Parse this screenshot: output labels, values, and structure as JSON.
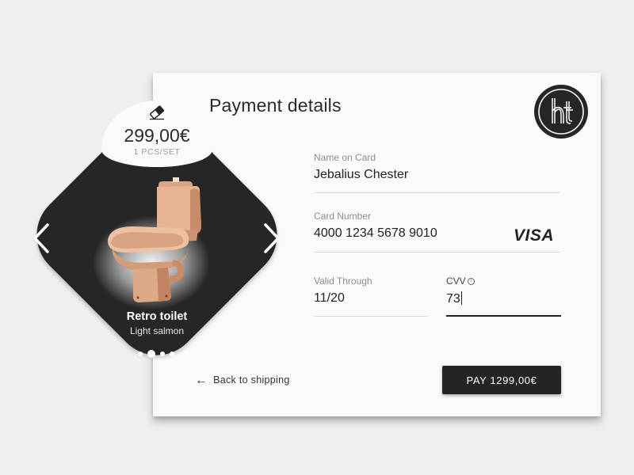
{
  "payment": {
    "title": "Payment details",
    "logo_icon": "ht-monogram-logo-icon",
    "fields": {
      "name": {
        "label": "Name on Card",
        "value": "Jebalius Chester"
      },
      "card_number": {
        "label": "Card Number",
        "value": "4000 1234 5678 9010",
        "brand": "VISA"
      },
      "valid_through": {
        "label": "Valid Through",
        "value": "11/20"
      },
      "cvv": {
        "label": "CVV",
        "value": "73",
        "info_glyph": "i"
      }
    },
    "back_link": {
      "arrow": "←",
      "label": "Back to shipping"
    },
    "pay_button": {
      "label": "PAY 1299,00€"
    }
  },
  "product": {
    "price": "299,00€",
    "unit": "1 PCS/SET",
    "name": "Retro toilet",
    "variant": "Light salmon",
    "carousel": {
      "count": 4,
      "active_index": 1
    },
    "icons": {
      "price_tag": "eraser-icon",
      "prev": "chevron-left-icon",
      "next": "chevron-right-icon"
    }
  },
  "colors": {
    "background": "#efefef",
    "card": "#fafafa",
    "dark": "#262626",
    "toilet": "#e7b594"
  }
}
